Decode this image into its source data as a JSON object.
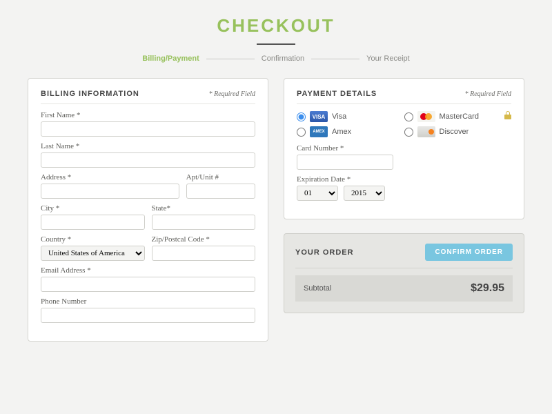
{
  "header": {
    "title": "CHECKOUT",
    "steps": [
      "Billing/Payment",
      "Confirmation",
      "Your Receipt"
    ]
  },
  "billing": {
    "heading": "BILLING INFORMATION",
    "required_note": "* Required Field",
    "labels": {
      "first_name": "First Name *",
      "last_name": "Last Name *",
      "address": "Address *",
      "apt": "Apt/Unit #",
      "city": "City *",
      "state": "State*",
      "country": "Country *",
      "zip": "Zip/Postcal Code *",
      "email": "Email Address *",
      "phone": "Phone Number"
    },
    "values": {
      "country": "United States of America"
    }
  },
  "payment": {
    "heading": "PAYMENT DETAILS",
    "required_note": "* Required Field",
    "methods": {
      "visa": "Visa",
      "mastercard": "MasterCard",
      "amex": "Amex",
      "discover": "Discover"
    },
    "selected_method": "visa",
    "labels": {
      "card_number": "Card Number *",
      "expiration": "Expiration Date *"
    },
    "exp_month": "01",
    "exp_year": "2015"
  },
  "order": {
    "heading": "YOUR ORDER",
    "confirm_label": "CONFIRM ORDER",
    "subtotal_label": "Subtotal",
    "subtotal_amount": "$29.95"
  }
}
